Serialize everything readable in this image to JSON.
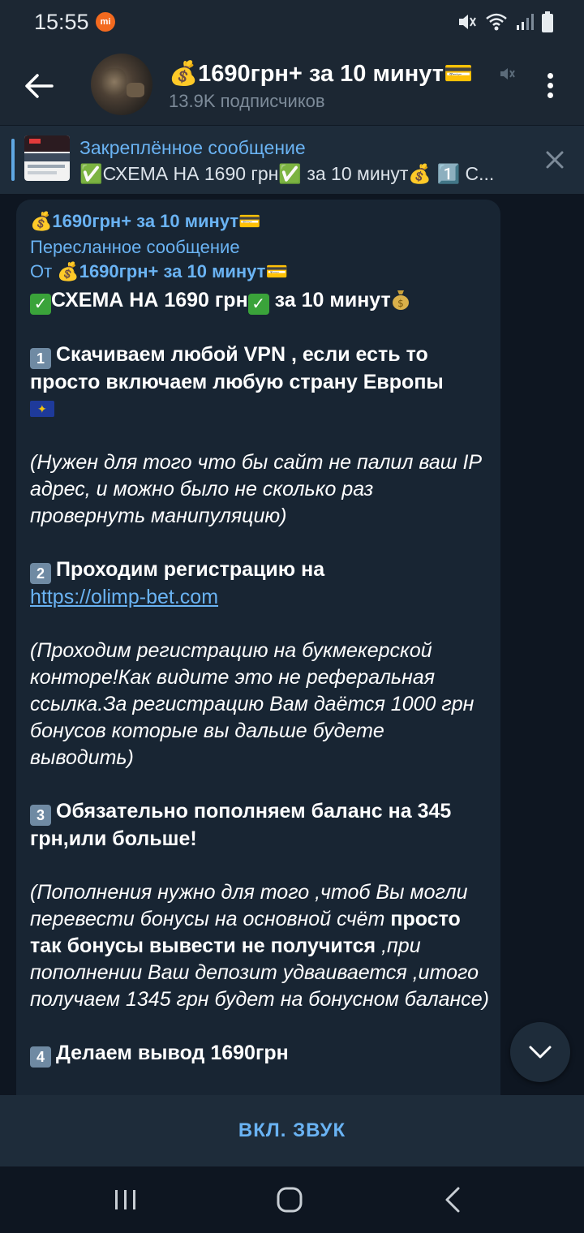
{
  "status_bar": {
    "time": "15:55",
    "mi_label": "mi",
    "icons": [
      "mi-icon",
      "mute-vibrate-icon",
      "wifi-icon",
      "signal-icon",
      "battery-icon"
    ]
  },
  "header": {
    "back_icon": "arrow-left-icon",
    "title": "💰1690грн+ за 10 минут💳",
    "subscribers": "13.9K подписчиков",
    "muted_icon": "speaker-muted-icon",
    "menu_icon": "more-vertical-icon"
  },
  "pinned": {
    "title": "Закреплённое сообщение",
    "text": "✅СХЕМА НА 1690 грн✅ за 10 минут💰 1️⃣ С..."
  },
  "message": {
    "author": "💰1690грн+ за 10 минут💳",
    "forwarded_label": "Пересланное сообщение",
    "forwarded_prefix": "От ",
    "forwarded_from": "💰1690грн+ за 10 минут💳",
    "headline": "СХЕМА НА 1690 грн",
    "headline_tail": " за 10 минут",
    "step1_num": "1",
    "step1_text": "Скачиваем любой VPN , если есть то просто включаем любую страну Европы",
    "step1_note": "(Нужен для того что бы сайт не палил ваш IP адрес, и можно было не сколько раз провернуть манипуляцию)",
    "step2_num": "2",
    "step2_text": "Проходим регистрацию на",
    "step2_link": "https://olimp-bet.com",
    "step2_note": "(Проходим регистрацию на букмекерской конторе!Как видите это не реферальная ссылка.За регистрацию Вам даётся 1000 грн бонусов которые вы дальше будете выводить)",
    "step3_num": "3",
    "step3_text": "Обязательно пополняем баланс на 345 грн,или больше!",
    "step3_note_a": "(Пополнения нужно для того ,чтоб Вы могли перевести бонусы на основной счёт ",
    "step3_note_bold": "просто так бонусы вывести не получится",
    "step3_note_b": " ,при пополнении Ваш депозит удваивается ,итого получаем 1345 грн будет на бонусном балансе)",
    "step4_num": "4",
    "step4_text": "Делаем вывод 1690грн"
  },
  "bottom_bar": {
    "label": "ВКЛ. ЗВУК"
  },
  "colors": {
    "background": "#0e1621",
    "header": "#1c2733",
    "bubble": "#182533",
    "accent": "#6ab3f3"
  }
}
